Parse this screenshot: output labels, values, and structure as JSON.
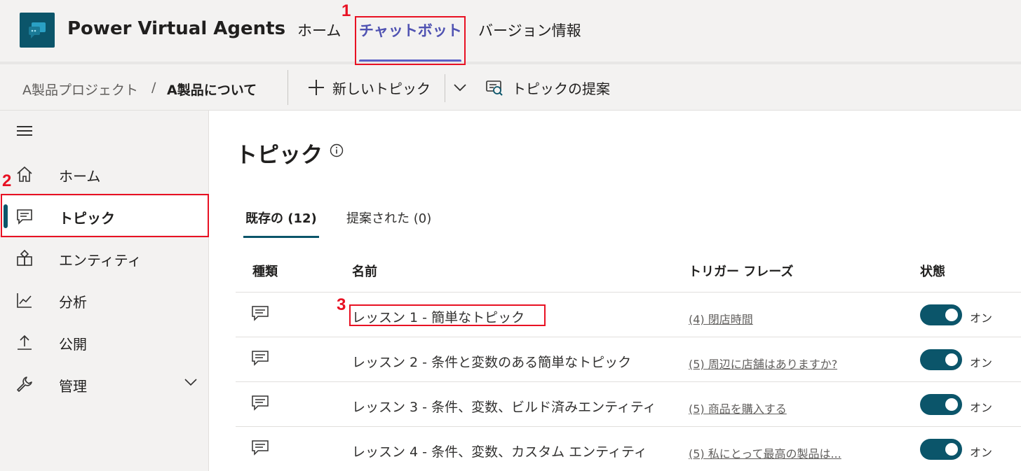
{
  "header": {
    "app_title": "Power Virtual Agents",
    "nav": [
      {
        "label": "ホーム",
        "active": false
      },
      {
        "label": "チャットボット",
        "active": true
      },
      {
        "label": "バージョン情報",
        "active": false
      }
    ]
  },
  "commandbar": {
    "breadcrumb_parent": "A製品プロジェクト",
    "breadcrumb_separator": "/",
    "breadcrumb_current": "A製品について",
    "new_topic_label": "新しいトピック",
    "suggest_topics_label": "トピックの提案"
  },
  "sidebar": {
    "items": [
      {
        "label": "ホーム",
        "icon": "home-icon"
      },
      {
        "label": "トピック",
        "icon": "chat-icon",
        "active": true
      },
      {
        "label": "エンティティ",
        "icon": "shapes-icon"
      },
      {
        "label": "分析",
        "icon": "line-chart-icon"
      },
      {
        "label": "公開",
        "icon": "upload-icon"
      },
      {
        "label": "管理",
        "icon": "wrench-icon",
        "expandable": true
      }
    ]
  },
  "main": {
    "title": "トピック",
    "tabs": [
      {
        "label": "既存の (12)",
        "active": true
      },
      {
        "label": "提案された (0)",
        "active": false
      }
    ],
    "columns": [
      "種類",
      "名前",
      "トリガー フレーズ",
      "状態"
    ],
    "rows": [
      {
        "name": "レッスン 1 - 簡単なトピック",
        "trigger": "(4) 閉店時間",
        "state": "オン"
      },
      {
        "name": "レッスン 2 - 条件と変数のある簡単なトピック",
        "trigger": "(5) 周辺に店舗はありますか?",
        "state": "オン"
      },
      {
        "name": "レッスン 3 - 条件、変数、ビルド済みエンティティ",
        "trigger": "(5) 商品を購入する",
        "state": "オン"
      },
      {
        "name": "レッスン 4 - 条件、変数、カスタム エンティティ",
        "trigger": "(5) 私にとって最高の製品は...",
        "state": "オン"
      }
    ]
  },
  "annotations": {
    "one": "1",
    "two": "2",
    "three": "3"
  },
  "colors": {
    "accent": "#0b556a",
    "nav_active": "#4f52b2",
    "annotation": "#e81123"
  }
}
